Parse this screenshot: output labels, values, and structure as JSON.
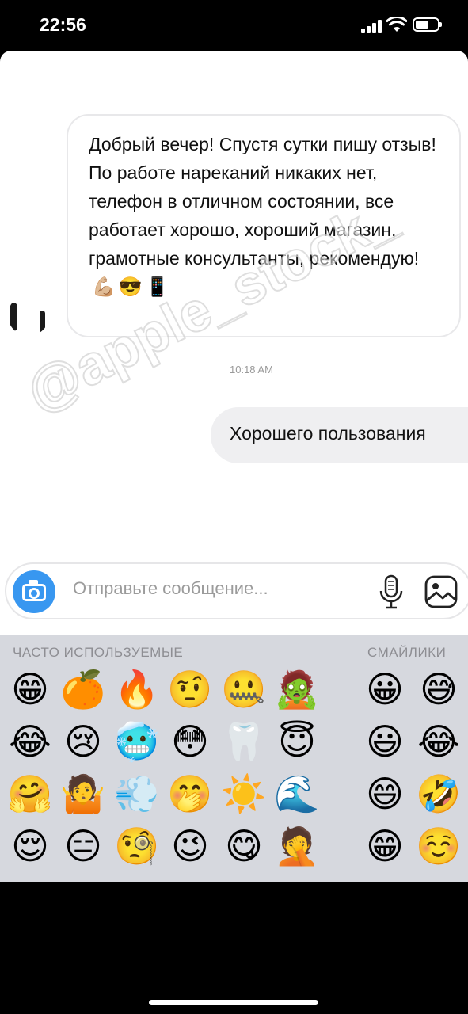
{
  "status": {
    "time": "22:56",
    "battery_level": 0.6
  },
  "chat": {
    "incoming": {
      "lines": [
        "Добрый вечер! Спустя сутки пишу отзыв!",
        "По работе нареканий никаких нет, телефон в отличном состоянии, все работает хорошо, хороший магазин, грамотные консультанты, рекомендую!"
      ],
      "emojis": [
        "💪🏼",
        "😎",
        "📱"
      ]
    },
    "timestamp": "10:18 AM",
    "outgoing": {
      "text": "Хорошего пользования"
    },
    "watermark": "@apple_stock_"
  },
  "composer": {
    "placeholder": "Отправьте сообщение..."
  },
  "emoji_keyboard": {
    "sections": {
      "frequent": "ЧАСТО ИСПОЛЬЗУЕМЫЕ",
      "smileys": "СМАЙЛИКИ"
    },
    "frequent_rows": [
      [
        "😁",
        "🍊",
        "🔥",
        "🤨",
        "🤐",
        "🧟"
      ],
      [
        "😂",
        "😢",
        "🥶",
        "😳",
        "🦷",
        "😇"
      ],
      [
        "🤗",
        "🤷",
        "💨",
        "🤭",
        "☀️",
        "🌊"
      ],
      [
        "😌",
        "😑",
        "🧐",
        "😉",
        "😋",
        "🤦"
      ]
    ],
    "smiley_rows": [
      [
        "😀",
        "😅"
      ],
      [
        "😃",
        "😂"
      ],
      [
        "😄",
        "🤣"
      ],
      [
        "😁",
        "☺️"
      ]
    ]
  },
  "icons": {
    "camera": "camera-icon",
    "microphone": "microphone-icon",
    "gallery": "gallery-icon",
    "accent_color": "#3897f0"
  }
}
